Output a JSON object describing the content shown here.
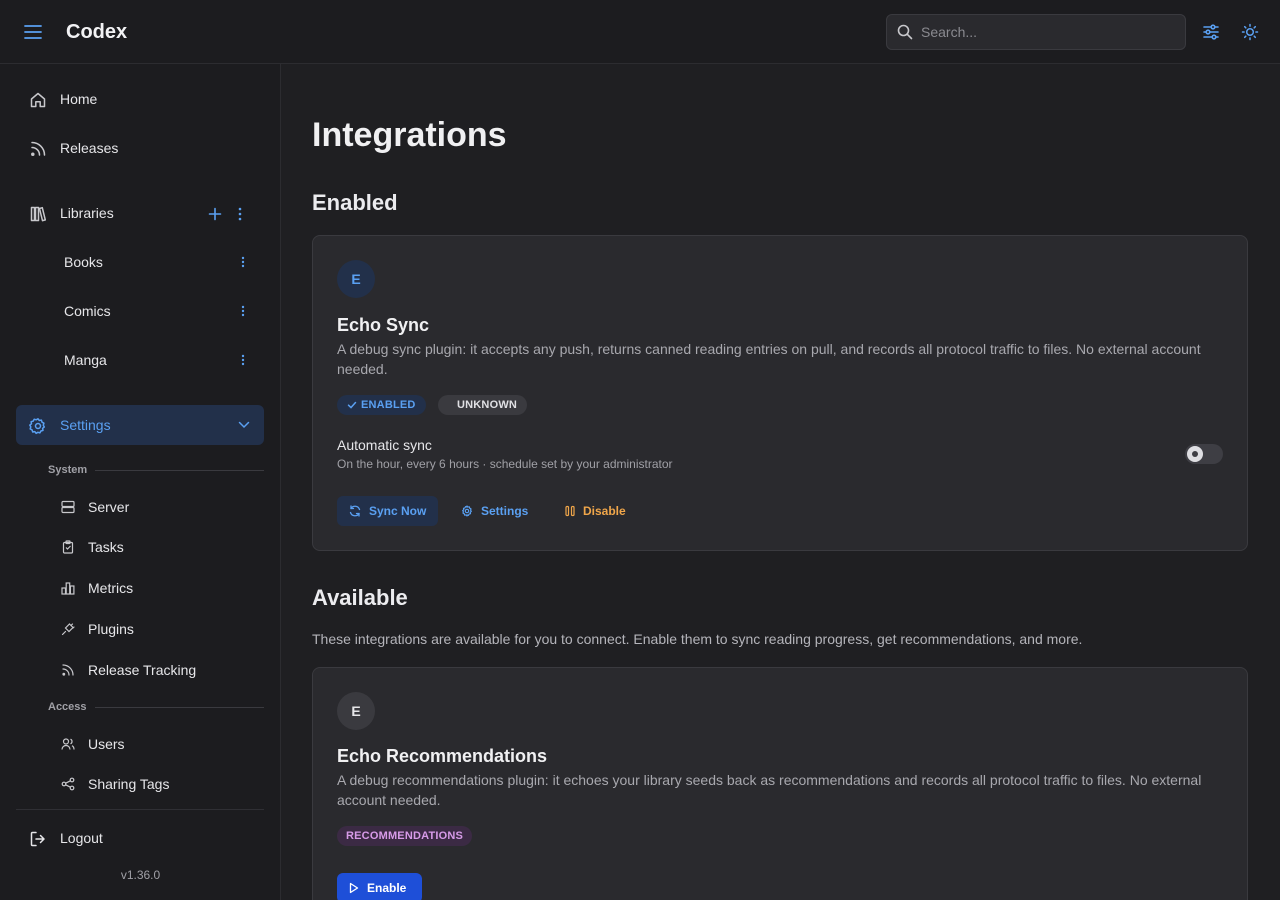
{
  "header": {
    "app_title": "Codex",
    "search_placeholder": "Search..."
  },
  "sidebar": {
    "home": "Home",
    "releases": "Releases",
    "libraries": "Libraries",
    "library_items": [
      "Books",
      "Comics",
      "Manga"
    ],
    "settings": "Settings",
    "system_label": "System",
    "system_items": [
      "Server",
      "Tasks",
      "Metrics",
      "Plugins",
      "Release Tracking"
    ],
    "access_label": "Access",
    "access_items": [
      "Users",
      "Sharing Tags"
    ],
    "logout": "Logout",
    "version": "v1.36.0"
  },
  "main": {
    "title": "Integrations",
    "enabled_heading": "Enabled",
    "available_heading": "Available",
    "available_description": "These integrations are available for you to connect. Enable them to sync reading progress, get recommendations, and more.",
    "enabled_card": {
      "avatar_letter": "E",
      "name": "Echo Sync",
      "description": "A debug sync plugin: it accepts any push, returns canned reading entries on pull, and records all protocol traffic to files. No external account needed.",
      "badges": [
        "ENABLED",
        "UNKNOWN"
      ],
      "sync_title": "Automatic sync",
      "sync_subtitle": "On the hour, every 6 hours · schedule set by your administrator",
      "auto_sync_on": false,
      "buttons": [
        "Sync Now",
        "Settings",
        "Disable"
      ]
    },
    "available_card": {
      "avatar_letter": "E",
      "name": "Echo Recommendations",
      "description": "A debug recommendations plugin: it echoes your library seeds back as recommendations and records all protocol traffic to files. No external account needed.",
      "badge": "RECOMMENDATIONS",
      "button": "Enable"
    }
  },
  "colors": {
    "accent": "#5aa0f2",
    "primary_button": "#1e4fd8",
    "warning": "#f0a64a",
    "recommendations_badge": "#d79be8"
  }
}
